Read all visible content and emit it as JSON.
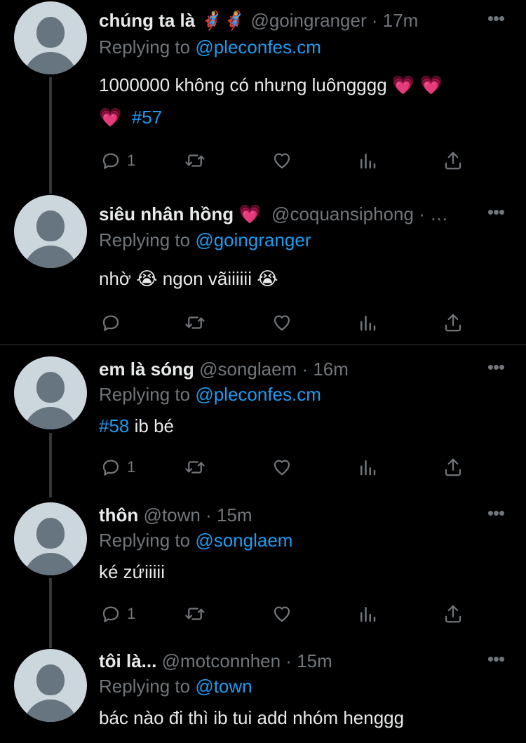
{
  "tweets": [
    {
      "name": "chúng ta là 🦸🏼‍♂️🦸🏼‍♀️",
      "handle": "@goingranger",
      "dot": "·",
      "time": "17m",
      "replying_prefix": "Replying to ",
      "replying_to": "@pleconfes.cm",
      "body_line1": "1000000 không có nhưng luôngggg 💗 💗",
      "body_line2_emoji": "💗",
      "body_line2_hashtag": "#57",
      "reply_count": "1",
      "more_icon": "more-horizontal-icon"
    },
    {
      "name": "siêu nhân hồng 💗",
      "handle": "@coquansiphong",
      "dot": "·",
      "time": "…",
      "replying_prefix": "Replying to ",
      "replying_to": "@goingranger",
      "body_line1": "nhờ 😭 ngon vãiiiiii 😭",
      "reply_count": "",
      "more_icon": "more-horizontal-icon"
    },
    {
      "name": "em là sóng",
      "handle": "@songlaem",
      "dot": "·",
      "time": "16m",
      "replying_prefix": "Replying to ",
      "replying_to": "@pleconfes.cm",
      "body_hashtag": "#58",
      "body_rest": " ib bé",
      "reply_count": "1",
      "more_icon": "more-horizontal-icon"
    },
    {
      "name": "thôn",
      "handle": "@town",
      "dot": "·",
      "time": "15m",
      "replying_prefix": "Replying to ",
      "replying_to": "@songlaem",
      "body_line1": "ké zứiiiii",
      "reply_count": "1",
      "more_icon": "more-horizontal-icon"
    },
    {
      "name": "tôi là...",
      "handle": "@motconnhen",
      "dot": "·",
      "time": "15m",
      "replying_prefix": "Replying to ",
      "replying_to": "@town",
      "body_line1": "bác nào đi thì ib tui add nhóm henggg",
      "more_icon": "more-horizontal-icon"
    }
  ],
  "icons": {
    "reply": "reply-icon",
    "retweet": "retweet-icon",
    "like": "heart-icon",
    "analytics": "analytics-icon",
    "share": "share-icon"
  },
  "colors": {
    "background": "#000000",
    "text": "#e7e9ea",
    "secondary": "#71767b",
    "link": "#1d9bf0",
    "avatar_bg": "#ccd6dd",
    "avatar_fg": "#66757f"
  }
}
